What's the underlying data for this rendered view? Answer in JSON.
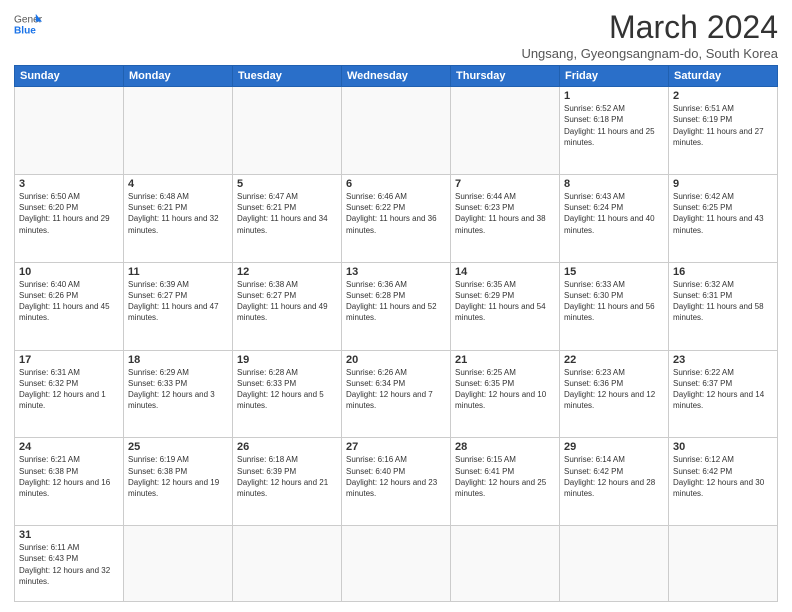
{
  "header": {
    "logo_general": "General",
    "logo_blue": "Blue",
    "title": "March 2024",
    "subtitle": "Ungsang, Gyeongsangnam-do, South Korea"
  },
  "days_of_week": [
    "Sunday",
    "Monday",
    "Tuesday",
    "Wednesday",
    "Thursday",
    "Friday",
    "Saturday"
  ],
  "weeks": [
    [
      {
        "day": "",
        "info": ""
      },
      {
        "day": "",
        "info": ""
      },
      {
        "day": "",
        "info": ""
      },
      {
        "day": "",
        "info": ""
      },
      {
        "day": "",
        "info": ""
      },
      {
        "day": "1",
        "info": "Sunrise: 6:52 AM\nSunset: 6:18 PM\nDaylight: 11 hours and 25 minutes."
      },
      {
        "day": "2",
        "info": "Sunrise: 6:51 AM\nSunset: 6:19 PM\nDaylight: 11 hours and 27 minutes."
      }
    ],
    [
      {
        "day": "3",
        "info": "Sunrise: 6:50 AM\nSunset: 6:20 PM\nDaylight: 11 hours and 29 minutes."
      },
      {
        "day": "4",
        "info": "Sunrise: 6:48 AM\nSunset: 6:21 PM\nDaylight: 11 hours and 32 minutes."
      },
      {
        "day": "5",
        "info": "Sunrise: 6:47 AM\nSunset: 6:21 PM\nDaylight: 11 hours and 34 minutes."
      },
      {
        "day": "6",
        "info": "Sunrise: 6:46 AM\nSunset: 6:22 PM\nDaylight: 11 hours and 36 minutes."
      },
      {
        "day": "7",
        "info": "Sunrise: 6:44 AM\nSunset: 6:23 PM\nDaylight: 11 hours and 38 minutes."
      },
      {
        "day": "8",
        "info": "Sunrise: 6:43 AM\nSunset: 6:24 PM\nDaylight: 11 hours and 40 minutes."
      },
      {
        "day": "9",
        "info": "Sunrise: 6:42 AM\nSunset: 6:25 PM\nDaylight: 11 hours and 43 minutes."
      }
    ],
    [
      {
        "day": "10",
        "info": "Sunrise: 6:40 AM\nSunset: 6:26 PM\nDaylight: 11 hours and 45 minutes."
      },
      {
        "day": "11",
        "info": "Sunrise: 6:39 AM\nSunset: 6:27 PM\nDaylight: 11 hours and 47 minutes."
      },
      {
        "day": "12",
        "info": "Sunrise: 6:38 AM\nSunset: 6:27 PM\nDaylight: 11 hours and 49 minutes."
      },
      {
        "day": "13",
        "info": "Sunrise: 6:36 AM\nSunset: 6:28 PM\nDaylight: 11 hours and 52 minutes."
      },
      {
        "day": "14",
        "info": "Sunrise: 6:35 AM\nSunset: 6:29 PM\nDaylight: 11 hours and 54 minutes."
      },
      {
        "day": "15",
        "info": "Sunrise: 6:33 AM\nSunset: 6:30 PM\nDaylight: 11 hours and 56 minutes."
      },
      {
        "day": "16",
        "info": "Sunrise: 6:32 AM\nSunset: 6:31 PM\nDaylight: 11 hours and 58 minutes."
      }
    ],
    [
      {
        "day": "17",
        "info": "Sunrise: 6:31 AM\nSunset: 6:32 PM\nDaylight: 12 hours and 1 minute."
      },
      {
        "day": "18",
        "info": "Sunrise: 6:29 AM\nSunset: 6:33 PM\nDaylight: 12 hours and 3 minutes."
      },
      {
        "day": "19",
        "info": "Sunrise: 6:28 AM\nSunset: 6:33 PM\nDaylight: 12 hours and 5 minutes."
      },
      {
        "day": "20",
        "info": "Sunrise: 6:26 AM\nSunset: 6:34 PM\nDaylight: 12 hours and 7 minutes."
      },
      {
        "day": "21",
        "info": "Sunrise: 6:25 AM\nSunset: 6:35 PM\nDaylight: 12 hours and 10 minutes."
      },
      {
        "day": "22",
        "info": "Sunrise: 6:23 AM\nSunset: 6:36 PM\nDaylight: 12 hours and 12 minutes."
      },
      {
        "day": "23",
        "info": "Sunrise: 6:22 AM\nSunset: 6:37 PM\nDaylight: 12 hours and 14 minutes."
      }
    ],
    [
      {
        "day": "24",
        "info": "Sunrise: 6:21 AM\nSunset: 6:38 PM\nDaylight: 12 hours and 16 minutes."
      },
      {
        "day": "25",
        "info": "Sunrise: 6:19 AM\nSunset: 6:38 PM\nDaylight: 12 hours and 19 minutes."
      },
      {
        "day": "26",
        "info": "Sunrise: 6:18 AM\nSunset: 6:39 PM\nDaylight: 12 hours and 21 minutes."
      },
      {
        "day": "27",
        "info": "Sunrise: 6:16 AM\nSunset: 6:40 PM\nDaylight: 12 hours and 23 minutes."
      },
      {
        "day": "28",
        "info": "Sunrise: 6:15 AM\nSunset: 6:41 PM\nDaylight: 12 hours and 25 minutes."
      },
      {
        "day": "29",
        "info": "Sunrise: 6:14 AM\nSunset: 6:42 PM\nDaylight: 12 hours and 28 minutes."
      },
      {
        "day": "30",
        "info": "Sunrise: 6:12 AM\nSunset: 6:42 PM\nDaylight: 12 hours and 30 minutes."
      }
    ],
    [
      {
        "day": "31",
        "info": "Sunrise: 6:11 AM\nSunset: 6:43 PM\nDaylight: 12 hours and 32 minutes."
      },
      {
        "day": "",
        "info": ""
      },
      {
        "day": "",
        "info": ""
      },
      {
        "day": "",
        "info": ""
      },
      {
        "day": "",
        "info": ""
      },
      {
        "day": "",
        "info": ""
      },
      {
        "day": "",
        "info": ""
      }
    ]
  ]
}
